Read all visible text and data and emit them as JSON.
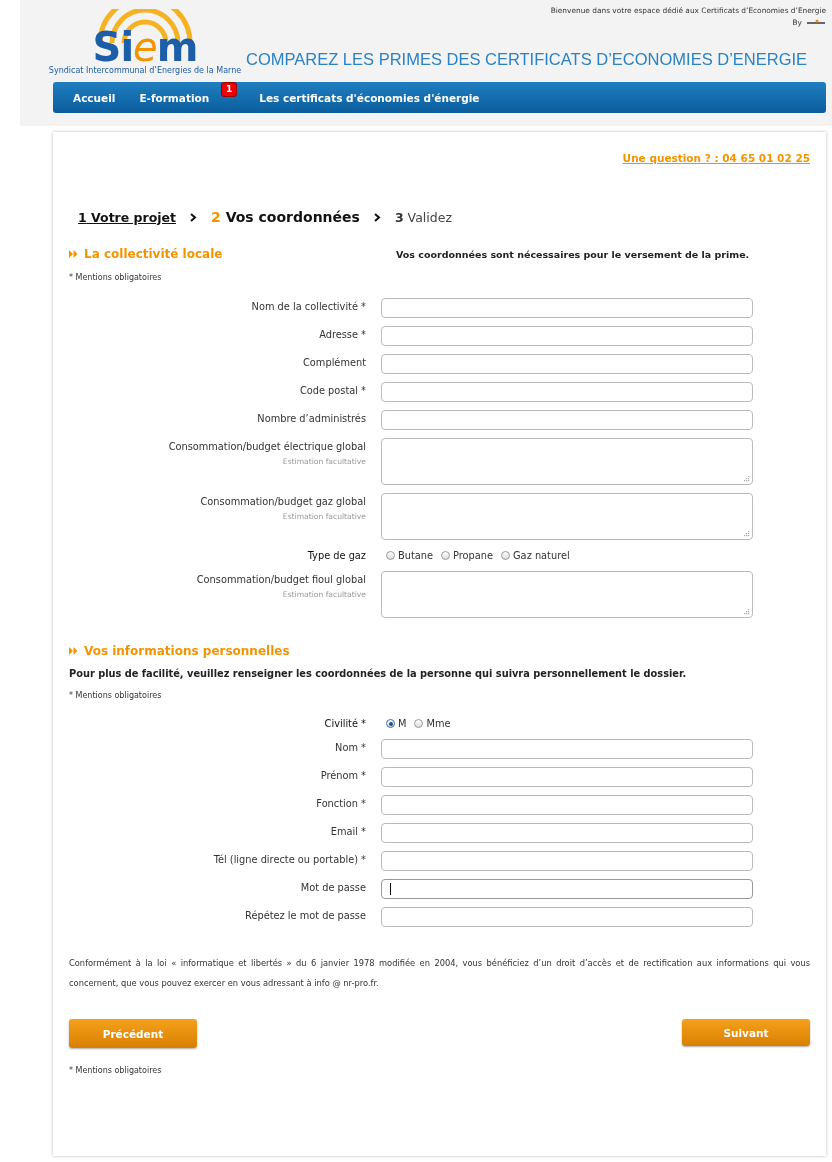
{
  "header": {
    "welcome": "Bienvenue dans votre espace dédié aux Certificats d’Economies d’Energie",
    "by": "By",
    "logo": {
      "lead": "Si",
      "accent": "e",
      "tail": "m",
      "subtitle": "Syndicat Intercommunal d’Energies de la Marne"
    },
    "headline": "COMPAREZ LES PRIMES DES CERTIFICATS D’ECONOMIES D’ENERGIE"
  },
  "nav": [
    {
      "label": "Accueil"
    },
    {
      "label": "E-formation",
      "badge": "1"
    },
    {
      "label": "Les certificats d'économies d'énergie"
    }
  ],
  "contact": "Une question ? : 04 65 01 02 25",
  "steps": [
    {
      "number": "1",
      "label": "Votre projet",
      "done": true,
      "selected": false
    },
    {
      "number": "2",
      "label": "Vos coordonnées",
      "done": false,
      "selected": true
    },
    {
      "number": "3",
      "label": "Validez",
      "done": false,
      "selected": false
    }
  ],
  "sections": [
    {
      "title": "La collectivité locale",
      "aside": "Vos coordonnées sont nécessaires pour le versement de la prime.",
      "note": "* Mentions obligatoires",
      "fields": [
        {
          "kind": "text",
          "label": "Nom de la collectivité *",
          "focused": false
        },
        {
          "kind": "text",
          "label": "Adresse *",
          "focused": false
        },
        {
          "kind": "text",
          "label": "Complément",
          "focused": false
        },
        {
          "kind": "text",
          "label": "Code postal *",
          "focused": false
        },
        {
          "kind": "text",
          "label": "Nombre d’administrés",
          "focused": false
        },
        {
          "kind": "textarea",
          "label": "Consommation/budget électrique global",
          "hint": "Estimation facultative"
        },
        {
          "kind": "textarea",
          "label": "Consommation/budget gaz global",
          "hint": "Estimation facultative"
        },
        {
          "kind": "radio",
          "label": "Type de gaz",
          "options": [
            {
              "label": "Butane",
              "selected": false
            },
            {
              "label": "Propane",
              "selected": false
            },
            {
              "label": "Gaz naturel",
              "selected": false
            }
          ]
        },
        {
          "kind": "textarea",
          "label": "Consommation/budget fioul global",
          "hint": "Estimation facultative"
        }
      ]
    },
    {
      "title": "Vos informations personnelles",
      "intro": "Pour plus de facilité, veuillez renseigner les coordonnées de la personne qui suivra personnellement le dossier.",
      "note": "* Mentions obligatoires",
      "fields": [
        {
          "kind": "radio",
          "label": "Civilité *",
          "options": [
            {
              "label": "M",
              "selected": true
            },
            {
              "label": "Mme",
              "selected": false
            }
          ]
        },
        {
          "kind": "text",
          "label": "Nom *",
          "focused": false
        },
        {
          "kind": "text",
          "label": "Prénom *",
          "focused": false
        },
        {
          "kind": "text",
          "label": "Fonction *",
          "focused": false
        },
        {
          "kind": "text",
          "label": "Email *",
          "focused": false
        },
        {
          "kind": "text",
          "label": "Tél (ligne directe ou portable) *",
          "focused": false
        },
        {
          "kind": "text",
          "label": "Mot de passe",
          "focused": true
        },
        {
          "kind": "text",
          "label": "Répétez le mot de passe",
          "focused": false
        }
      ]
    }
  ],
  "legal": "Conformément à la loi « informatique et libertés » du 6 janvier 1978 modifiée en 2004, vous bénéficiez d’un droit d’accès et de rectification aux informations qui vous concernent, que vous pouvez exercer en vous adressant à info @ nr-pro.fr.",
  "buttons": {
    "previous": "Précédent",
    "next": "Suivant"
  },
  "footnote": "* Mentions obligatoires"
}
